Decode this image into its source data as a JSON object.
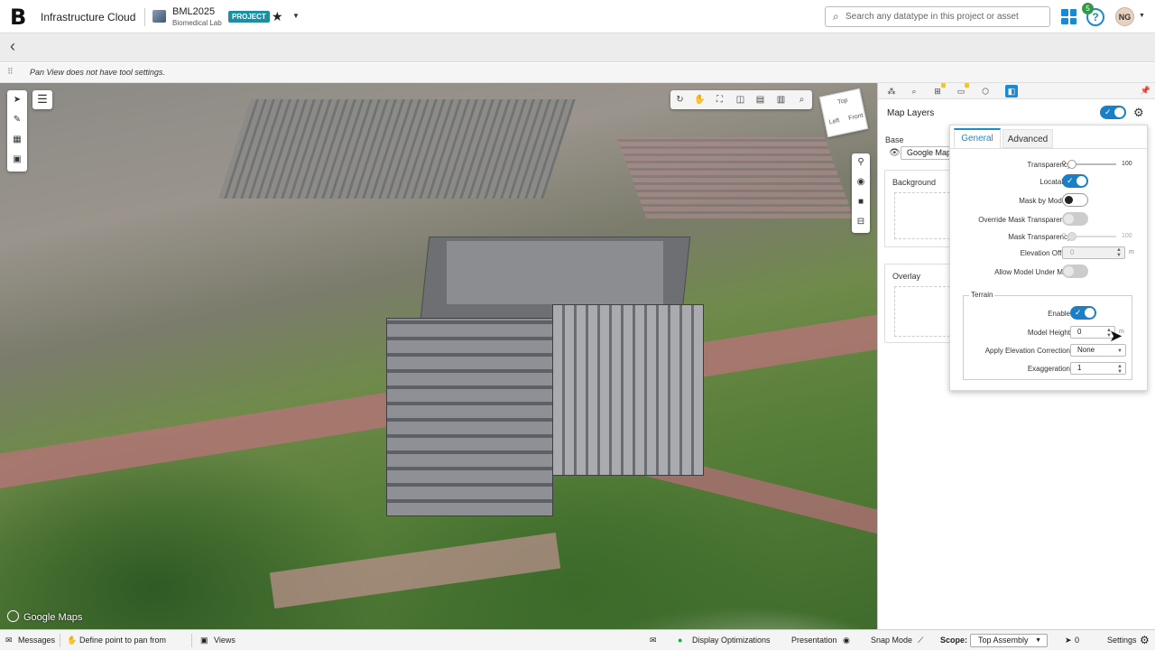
{
  "app": {
    "logo": "B",
    "name": "Infrastructure Cloud"
  },
  "project": {
    "name": "BML2025",
    "subtitle": "Biomedical Lab",
    "badge": "PROJECT"
  },
  "search": {
    "placeholder": "Search any datatype in this project or asset"
  },
  "header": {
    "help_badge": "5",
    "help_label": "?",
    "avatar_initials": "NG"
  },
  "tool_settings": {
    "message": "Pan View does not have tool settings."
  },
  "viewport": {
    "attribution": "Google Maps",
    "view_cube": {
      "top": "Top",
      "left": "Left",
      "front": "Front"
    }
  },
  "panel": {
    "title": "Map Layers",
    "base_label": "Base",
    "base_value": "Google Maps",
    "background_label": "Background",
    "overlay_label": "Overlay"
  },
  "settings_popup": {
    "tabs": [
      {
        "label": "General",
        "active": true
      },
      {
        "label": "Advanced",
        "active": false
      }
    ],
    "transparency": {
      "label": "Transparency",
      "min": "0",
      "max": "100",
      "value": 0
    },
    "locatable": {
      "label": "Locatable",
      "on": true
    },
    "mask_by_models": {
      "label": "Mask by Models",
      "on": false
    },
    "override_mask_transparency": {
      "label": "Override Mask Transparency",
      "on": false
    },
    "mask_transparency": {
      "label": "Mask Transparency",
      "min": "0",
      "max": "100",
      "value": 0
    },
    "elevation_offset": {
      "label": "Elevation Offset",
      "value": "0",
      "unit": "m"
    },
    "allow_model_under_map": {
      "label": "Allow Model Under Map",
      "on": false
    },
    "terrain": {
      "title": "Terrain",
      "enable": {
        "label": "Enable",
        "on": true
      },
      "model_height": {
        "label": "Model Height",
        "value": "0",
        "unit": "m"
      },
      "apply_elevation_correction": {
        "label": "Apply Elevation Correction",
        "value": "None"
      },
      "exaggeration": {
        "label": "Exaggeration",
        "value": "1"
      }
    }
  },
  "status_bar": {
    "messages": "Messages",
    "define_point": "Define point to pan from",
    "views": "Views",
    "display_optimizations": "Display Optimizations",
    "presentation": "Presentation",
    "snap_mode": "Snap Mode",
    "scope_label": "Scope:",
    "scope_value": "Top Assembly",
    "selection_count": "0",
    "settings": "Settings"
  },
  "colors": {
    "accent": "#1a8ad4",
    "badge": "#1d8fa3",
    "toggle_on": "#1a7fc4",
    "help_badge": "#2e9b47"
  }
}
